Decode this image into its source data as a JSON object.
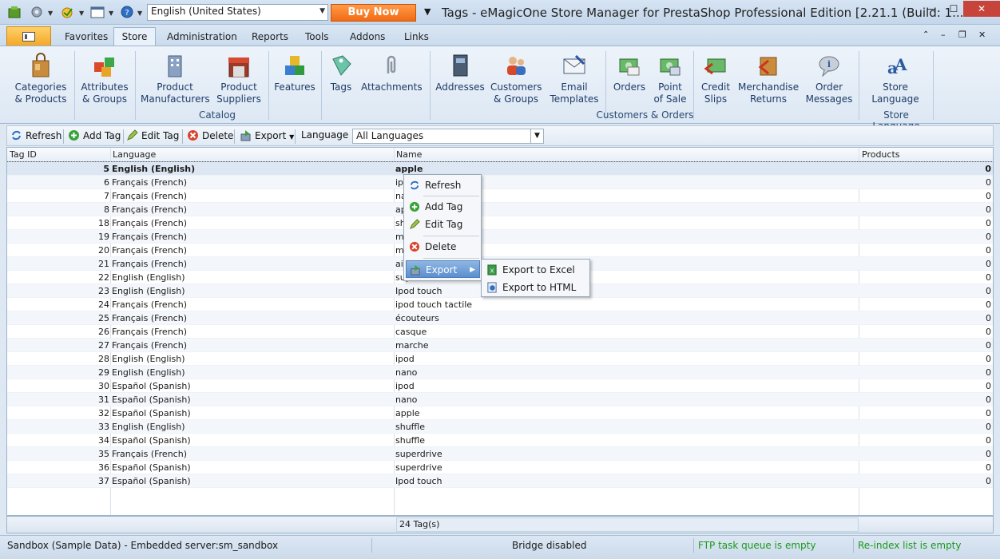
{
  "window": {
    "title": "Tags - eMagicOne Store Manager for PrestaShop Professional Edition [2.21.1 (Build: 1...",
    "language_selector": "English (United States)",
    "buy_now": "Buy Now"
  },
  "tabs": [
    "Favorites",
    "Store",
    "Administration",
    "Reports",
    "Tools",
    "Addons",
    "Links"
  ],
  "ribbon": {
    "catalog_items": [
      {
        "line1": "Categories",
        "line2": "& Products"
      },
      {
        "line1": "Attributes",
        "line2": "& Groups"
      },
      {
        "line1": "Product",
        "line2": "Manufacturers"
      },
      {
        "line1": "Product",
        "line2": "Suppliers"
      },
      {
        "line1": "Features",
        "line2": ""
      },
      {
        "line1": "Tags",
        "line2": ""
      },
      {
        "line1": "Attachments",
        "line2": ""
      }
    ],
    "catalog_label": "Catalog",
    "customer_items": [
      {
        "line1": "Addresses",
        "line2": ""
      },
      {
        "line1": "Customers",
        "line2": "& Groups"
      },
      {
        "line1": "Email",
        "line2": "Templates"
      },
      {
        "line1": "Orders",
        "line2": ""
      },
      {
        "line1": "Point",
        "line2": "of Sale"
      },
      {
        "line1": "Credit",
        "line2": "Slips"
      },
      {
        "line1": "Merchandise",
        "line2": "Returns"
      },
      {
        "line1": "Order",
        "line2": "Messages"
      }
    ],
    "customer_label": "Customers & Orders",
    "store_language_item": {
      "line1": "Store",
      "line2": "Language"
    },
    "store_language_label": "Store Language"
  },
  "toolbar": {
    "refresh": "Refresh",
    "add_tag": "Add Tag",
    "edit_tag": "Edit Tag",
    "delete": "Delete",
    "export": "Export",
    "language_label": "Language",
    "language_value": "All Languages"
  },
  "grid": {
    "columns": [
      "Tag ID",
      "Language",
      "Name",
      "Products"
    ],
    "rows": [
      {
        "id": "5",
        "lang": "English (English)",
        "name": "apple",
        "products": "0"
      },
      {
        "id": "6",
        "lang": "Français (French)",
        "name": "ipod",
        "products": "0"
      },
      {
        "id": "7",
        "lang": "Français (French)",
        "name": "nano",
        "products": "0"
      },
      {
        "id": "8",
        "lang": "Français (French)",
        "name": "apple",
        "products": "0"
      },
      {
        "id": "18",
        "lang": "Français (French)",
        "name": "shuffle",
        "products": "0"
      },
      {
        "id": "19",
        "lang": "Français (French)",
        "name": "macbook",
        "products": "0"
      },
      {
        "id": "20",
        "lang": "Français (French)",
        "name": "macbook air",
        "products": "0"
      },
      {
        "id": "21",
        "lang": "Français (French)",
        "name": "air",
        "products": "0"
      },
      {
        "id": "22",
        "lang": "English (English)",
        "name": "superdrive",
        "products": "0"
      },
      {
        "id": "23",
        "lang": "English (English)",
        "name": "Ipod touch",
        "products": "0"
      },
      {
        "id": "24",
        "lang": "Français (French)",
        "name": "ipod touch tactile",
        "products": "0"
      },
      {
        "id": "25",
        "lang": "Français (French)",
        "name": "écouteurs",
        "products": "0"
      },
      {
        "id": "26",
        "lang": "Français (French)",
        "name": "casque",
        "products": "0"
      },
      {
        "id": "27",
        "lang": "Français (French)",
        "name": "marche",
        "products": "0"
      },
      {
        "id": "28",
        "lang": "English (English)",
        "name": "ipod",
        "products": "0"
      },
      {
        "id": "29",
        "lang": "English (English)",
        "name": "nano",
        "products": "0"
      },
      {
        "id": "30",
        "lang": "Español (Spanish)",
        "name": "ipod",
        "products": "0"
      },
      {
        "id": "31",
        "lang": "Español (Spanish)",
        "name": "nano",
        "products": "0"
      },
      {
        "id": "32",
        "lang": "Español (Spanish)",
        "name": "apple",
        "products": "0"
      },
      {
        "id": "33",
        "lang": "English (English)",
        "name": "shuffle",
        "products": "0"
      },
      {
        "id": "34",
        "lang": "Español (Spanish)",
        "name": "shuffle",
        "products": "0"
      },
      {
        "id": "35",
        "lang": "Français (French)",
        "name": "superdrive",
        "products": "0"
      },
      {
        "id": "36",
        "lang": "Español (Spanish)",
        "name": "superdrive",
        "products": "0"
      },
      {
        "id": "37",
        "lang": "Español (Spanish)",
        "name": "Ipod touch",
        "products": "0"
      }
    ],
    "footer_count": "24 Tag(s)"
  },
  "context_menu": {
    "refresh": "Refresh",
    "add_tag": "Add Tag",
    "edit_tag": "Edit Tag",
    "delete": "Delete",
    "export": "Export",
    "export_excel": "Export to Excel",
    "export_html": "Export to HTML"
  },
  "status": {
    "connection": "Sandbox (Sample Data) - Embedded server:sm_sandbox",
    "bridge": "Bridge disabled",
    "ftp": "FTP task queue is empty",
    "reindex": "Re-index list is empty"
  },
  "colors": {
    "accent": "#f26a10",
    "status_green": "#1a9a1a",
    "selection": "#dde7f3",
    "menu_highlight": "#5b8fcf"
  }
}
